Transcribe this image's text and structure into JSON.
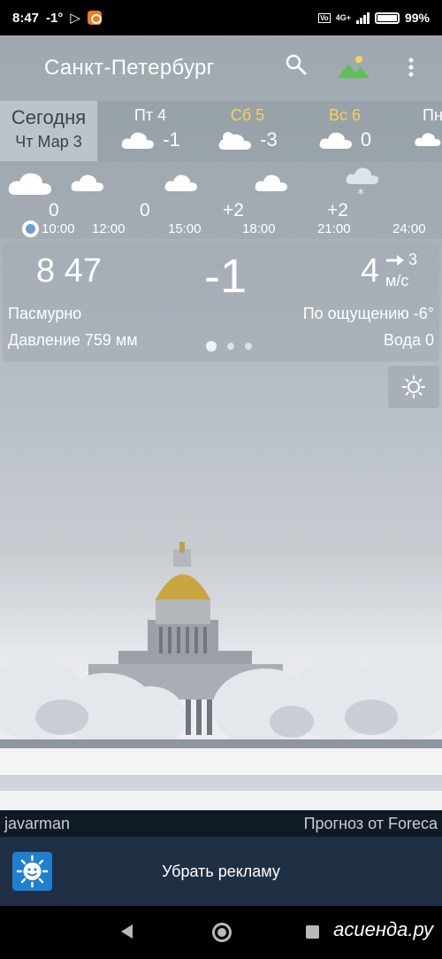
{
  "status_bar": {
    "time": "8:47",
    "temp": "-1°",
    "battery": "99%",
    "network": "4G+"
  },
  "toolbar": {
    "city": "Санкт-Петербург"
  },
  "days": [
    {
      "name": "Сегодня",
      "sub": "Чт Мар 3"
    },
    {
      "name": "Пт 4",
      "temp": "-1",
      "icon": "cloud-icon"
    },
    {
      "name": "Сб 5",
      "temp": "-3",
      "icon": "partly-cloudy-icon",
      "color": "#f3d25a"
    },
    {
      "name": "Вс 6",
      "temp": "0",
      "icon": "cloud-icon",
      "color": "#f3d25a"
    },
    {
      "name": "Пн",
      "icon": "cloud-icon"
    }
  ],
  "hourly": {
    "temps": [
      "0",
      "0",
      "+2",
      "+2"
    ],
    "times": [
      "10:00",
      "12:00",
      "15:00",
      "18:00",
      "21:00",
      "24:00"
    ]
  },
  "current": {
    "time": "8 47",
    "temp": "-1",
    "wind_speed": "4",
    "wind_dir_value": "3",
    "wind_unit": "м/с",
    "condition": "Пасмурно",
    "feels_like": "По ощущению -6°",
    "pressure": "Давление 759 мм",
    "water": "Вода 0"
  },
  "credit": {
    "author": "javarman",
    "source": "Прогноз от Foreca"
  },
  "ad": {
    "label": "Убрать рекламу"
  },
  "watermark": "асиенда.ру",
  "colors": {
    "accent_yellow": "#f3d25a",
    "bar_dark": "#1f2f44",
    "ad_icon_blue": "#1f7fd0"
  }
}
